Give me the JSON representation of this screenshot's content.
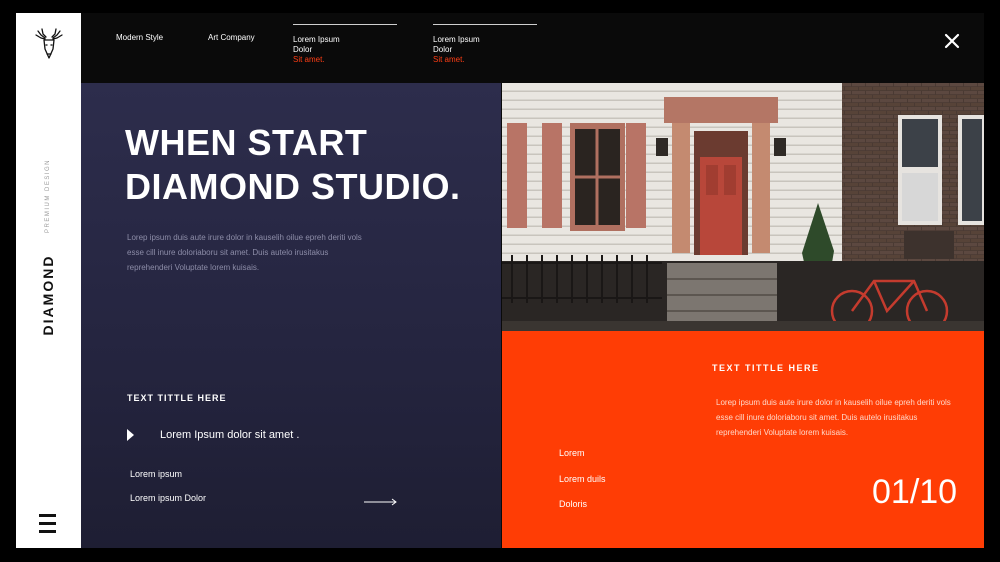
{
  "sidebar": {
    "brand": "DIAMOND",
    "brand_sub": "PREMIUM DESIGN",
    "logo_icon": "deer-head-icon",
    "menu_icon": "hamburger-menu-icon"
  },
  "nav": {
    "item1": "Modern Style",
    "item2": "Art Company",
    "group1": {
      "line1": "Lorem Ipsum",
      "line2": "Dolor",
      "line3": "Sit amet."
    },
    "group2": {
      "line1": "Lorem Ipsum",
      "line2": "Dolor",
      "line3": "Sit amet."
    },
    "close_icon": "close-icon"
  },
  "hero": {
    "headline_line1": "WHEN START",
    "headline_line2": "DIAMOND STUDIO.",
    "intro": "Lorep ipsum duis aute irure dolor in kauselih oilue epreh deriti vols esse cill inure doloriaboru sit amet. Duis autelo irusitakus reprehenderi Voluptate lorem kuisais.",
    "section_title": "TEXT TITTLE HERE",
    "play_text": "Lorem Ipsum dolor sit amet .",
    "sub1": "Lorem ipsum",
    "sub2": "Lorem ipsum  Dolor"
  },
  "info": {
    "title": "TEXT TITTLE HERE",
    "text": "Lorep ipsum duis aute irure dolor in kauselih oilue epreh deriti vols esse cill inure doloriaboru sit amet. Duis autelo irusitakus reprehenderi Voluptate lorem kuisais.",
    "item1": "Lorem",
    "item2": "Lorem duils",
    "item3": "Doloris",
    "counter": "01/10"
  },
  "colors": {
    "accent": "#ff3d05",
    "dark_panel": "#2a2a45",
    "topbar": "#0a0a0a"
  }
}
